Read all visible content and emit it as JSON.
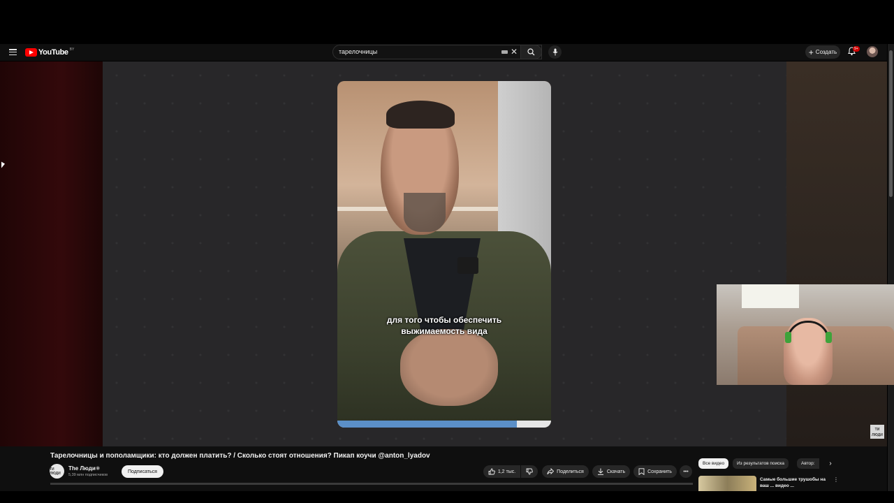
{
  "header": {
    "logo_text": "YouTube",
    "logo_country": "BY",
    "search_value": "тарелочницы",
    "create_label": "Создать",
    "notifications_badge": "9+"
  },
  "player": {
    "subtitle_line1": "для того чтобы обеспечить",
    "subtitle_line2": "выжимаемость вида",
    "progress_fraction": 0.84,
    "corner_logo": "ТИ ЛЮДИ"
  },
  "video": {
    "title": "Тарелочницы и пополамщики: кто должен платить? / Сколько стоят отношения? Пикап коучи @anton_lyadov",
    "channel_avatar_text": "ТИ ЛЮДИ",
    "channel_name": "The Люди",
    "channel_subs": "5,39 млн подписчиков",
    "subscribe_label": "Подписаться",
    "like_count": "1,2 тыс.",
    "share_label": "Поделиться",
    "download_label": "Скачать",
    "save_label": "Сохранить"
  },
  "sidebar": {
    "filters": [
      "Все видео",
      "Из результатов поиска",
      "Автор:"
    ],
    "recommendation_title": "Самые большие трушобы на ваш ... видео ..."
  },
  "colors": {
    "brand_red": "#ff0000",
    "background": "#0f0f0f",
    "progress_blue": "#5b8fc7"
  },
  "icons": [
    "menu-icon",
    "youtube-logo-icon",
    "keyboard-icon",
    "clear-icon",
    "search-icon",
    "mic-icon",
    "plus-icon",
    "bell-icon",
    "like-icon",
    "dislike-icon",
    "share-icon",
    "download-icon",
    "save-icon",
    "more-icon",
    "chevron-right-icon"
  ]
}
